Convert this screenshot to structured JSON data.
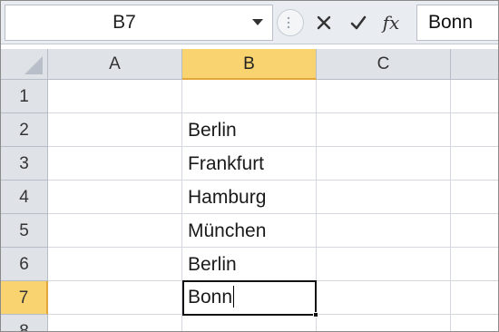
{
  "name_box": {
    "value": "B7"
  },
  "formula_bar": {
    "cancel_icon": "x-icon",
    "enter_icon": "check-icon",
    "insert_function_label": "fx",
    "value": "Bonn"
  },
  "columns": [
    "A",
    "B",
    "C"
  ],
  "selected_column": "B",
  "rows": [
    "1",
    "2",
    "3",
    "4",
    "5",
    "6",
    "7",
    "8"
  ],
  "selected_row": "7",
  "column_b_cells": [
    "",
    "Berlin",
    "Frankfurt",
    "Hamburg",
    "München",
    "Berlin",
    "Bonn"
  ],
  "active_cell": "B7",
  "colors": {
    "header_bg": "#dfe3e8",
    "selected_header_bg": "#f9d36f",
    "gridline": "#d4d8de"
  }
}
